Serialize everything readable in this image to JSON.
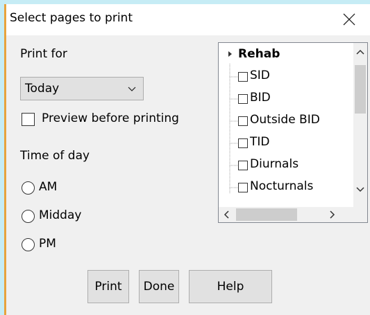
{
  "dialog": {
    "title": "Select pages to print",
    "close_icon": "close-icon"
  },
  "print_for": {
    "label": "Print for",
    "selected": "Today",
    "preview_label": "Preview before printing",
    "preview_checked": false
  },
  "time_of_day": {
    "label": "Time of day",
    "options": [
      {
        "label": "AM",
        "selected": false
      },
      {
        "label": "Midday",
        "selected": false
      },
      {
        "label": "PM",
        "selected": false
      }
    ]
  },
  "tree": {
    "root": "Rehab",
    "items": [
      {
        "label": "SID",
        "checked": false
      },
      {
        "label": "BID",
        "checked": false
      },
      {
        "label": "Outside BID",
        "checked": false
      },
      {
        "label": "TID",
        "checked": false
      },
      {
        "label": "Diurnals",
        "checked": false
      },
      {
        "label": "Nocturnals",
        "checked": false
      }
    ]
  },
  "buttons": {
    "print": "Print",
    "done": "Done",
    "help": "Help"
  }
}
